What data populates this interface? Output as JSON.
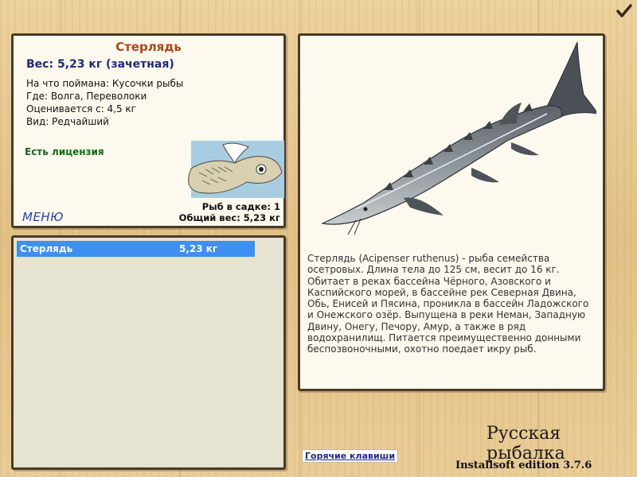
{
  "info": {
    "title": "Стерлядь",
    "weight": "Вес: 5,23 кг (зачетная)",
    "bait": "На что поймана: Кусочки рыбы",
    "place": "Где: Волга, Переволоки",
    "value": "Оценивается с: 4,5 кг",
    "rarity": "Вид: Редчайший",
    "license": "Есть лицензия",
    "fish_in_cage": "Рыб в садке: 1",
    "total_weight": "Общий вес: 5,23 кг",
    "menu": "МЕНЮ"
  },
  "catch_list": [
    {
      "name": "Стерлядь",
      "weight": "5,23 кг"
    }
  ],
  "fish": {
    "description": "Стерлядь (Acipenser ruthenus) - рыба семейства осетровых. Длина тела до 125 см, весит до 16 кг. Обитает в реках бассейна Чёрного, Азовского и Каспийского морей, в бассейне рек Северная Двина, Обь, Енисей и Пясина, проникла в бассейн Ладожского и Онежского озёр. Выпущена в реки Неман, Западную Двину, Онегу, Печору, Амур, а также в ряд водохранилищ. Питается преимущественно донными беспозвоночными, охотно поедает икру рыб.",
    "image_icon": "sterlet-fish"
  },
  "footer": {
    "hotkeys": "Горячие клавиши",
    "brand": "Русская рыбалка",
    "edition": "Installsoft edition 3.7.6"
  },
  "icons": {
    "confirm": "checkmark-icon",
    "thumbnail": "fish-drawing-thumbnail"
  },
  "colors": {
    "title": "#b0441a",
    "weight": "#1e2a7a",
    "license": "#0e6a1a",
    "selected_row": "#3d8ff0",
    "menu": "#2c3fa8"
  }
}
